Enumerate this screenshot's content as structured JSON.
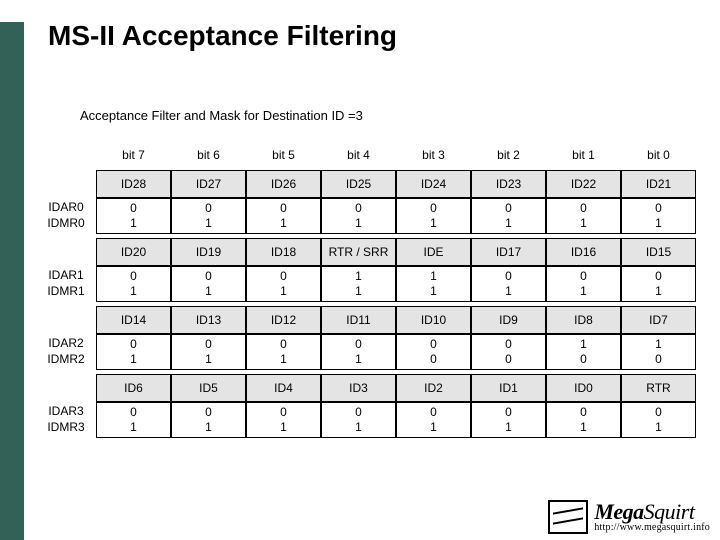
{
  "title": "MS-II Acceptance Filtering",
  "subtitle": "Acceptance Filter and Mask for Destination ID =3",
  "bit_headers": [
    "bit 7",
    "bit 6",
    "bit 5",
    "bit 4",
    "bit 3",
    "bit 2",
    "bit 1",
    "bit 0"
  ],
  "groups": [
    {
      "row_labels": [
        "IDAR0",
        "IDMR0"
      ],
      "ids": [
        "ID28",
        "ID27",
        "ID26",
        "ID25",
        "ID24",
        "ID23",
        "ID22",
        "ID21"
      ],
      "bold": [
        false,
        false,
        false,
        false,
        false,
        false,
        false,
        false
      ],
      "vals": [
        [
          "0",
          "1"
        ],
        [
          "0",
          "1"
        ],
        [
          "0",
          "1"
        ],
        [
          "0",
          "1"
        ],
        [
          "0",
          "1"
        ],
        [
          "0",
          "1"
        ],
        [
          "0",
          "1"
        ],
        [
          "0",
          "1"
        ]
      ]
    },
    {
      "row_labels": [
        "IDAR1",
        "IDMR1"
      ],
      "ids": [
        "ID20",
        "ID19",
        "ID18",
        "RTR / SRR",
        "IDE",
        "ID17",
        "ID16",
        "ID15"
      ],
      "bold": [
        false,
        false,
        false,
        false,
        false,
        false,
        false,
        false
      ],
      "small": [
        false,
        false,
        false,
        true,
        false,
        false,
        false,
        false
      ],
      "vals": [
        [
          "0",
          "1"
        ],
        [
          "0",
          "1"
        ],
        [
          "0",
          "1"
        ],
        [
          "1",
          "1"
        ],
        [
          "1",
          "1"
        ],
        [
          "0",
          "1"
        ],
        [
          "0",
          "1"
        ],
        [
          "0",
          "1"
        ]
      ]
    },
    {
      "row_labels": [
        "IDAR2",
        "IDMR2"
      ],
      "ids": [
        "ID14",
        "ID13",
        "ID12",
        "ID11",
        "ID10",
        "ID9",
        "ID8",
        "ID7"
      ],
      "bold": [
        false,
        false,
        false,
        false,
        true,
        true,
        true,
        true
      ],
      "vals": [
        [
          "0",
          "1"
        ],
        [
          "0",
          "1"
        ],
        [
          "0",
          "1"
        ],
        [
          "0",
          "1"
        ],
        [
          "0",
          "0"
        ],
        [
          "0",
          "0"
        ],
        [
          "1",
          "0"
        ],
        [
          "1",
          "0"
        ]
      ]
    },
    {
      "row_labels": [
        "IDAR3",
        "IDMR3"
      ],
      "ids": [
        "ID6",
        "ID5",
        "ID4",
        "ID3",
        "ID2",
        "ID1",
        "ID0",
        "RTR"
      ],
      "bold": [
        false,
        false,
        false,
        false,
        false,
        false,
        false,
        false
      ],
      "vals": [
        [
          "0",
          "1"
        ],
        [
          "0",
          "1"
        ],
        [
          "0",
          "1"
        ],
        [
          "0",
          "1"
        ],
        [
          "0",
          "1"
        ],
        [
          "0",
          "1"
        ],
        [
          "0",
          "1"
        ],
        [
          "0",
          "1"
        ]
      ]
    }
  ],
  "logo": {
    "brand_a": "Mega",
    "brand_b": "Squirt",
    "url": "http://www.megasquirt.info"
  }
}
